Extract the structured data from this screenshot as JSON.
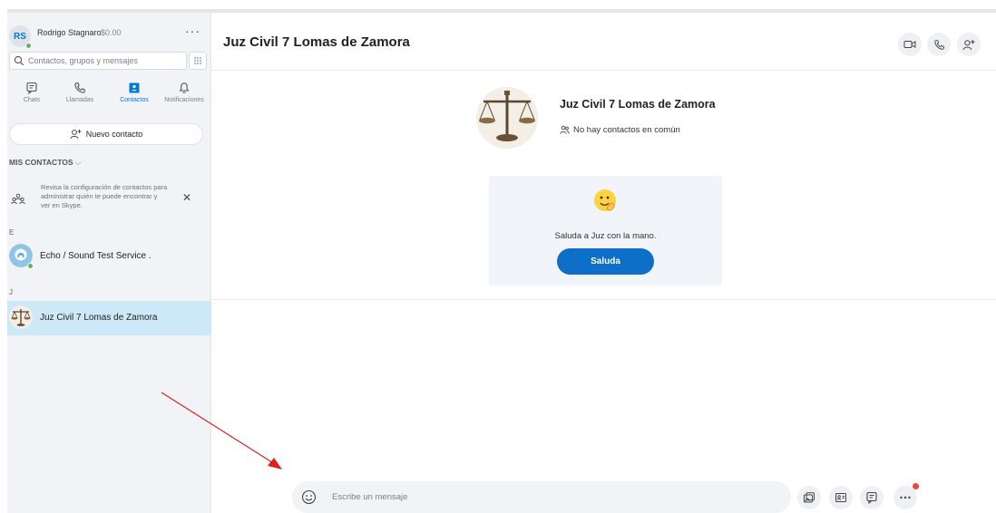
{
  "profile": {
    "initials": "RS",
    "name": "Rodrigo Stagnaro",
    "credit": "$0.00",
    "more": "···"
  },
  "search": {
    "placeholder": "Contactos, grupos y mensajes"
  },
  "nav": [
    {
      "label": "Chats",
      "icon": "chat-icon",
      "active": false
    },
    {
      "label": "Llamadas",
      "icon": "phone-icon",
      "active": false
    },
    {
      "label": "Contactos",
      "icon": "contacts-icon",
      "active": true
    },
    {
      "label": "Notificaciones",
      "icon": "bell-icon",
      "active": false
    }
  ],
  "new_contact": {
    "label": "Nuevo contacto"
  },
  "section": {
    "title": "MIS CONTACTOS",
    "chevron": "⌵"
  },
  "tip": {
    "text": "Revisa la configuración de contactos para administrar quién te puede encontrar y ver en Skype.",
    "close": "✕"
  },
  "contacts": [
    {
      "letter": "E",
      "name": "Echo / Sound Test Service ."
    },
    {
      "letter": "J",
      "name": "Juz Civil 7 Lomas de Zamora",
      "selected": true
    }
  ],
  "chat": {
    "title": "Juz Civil 7 Lomas de Zamora",
    "card_name": "Juz Civil 7 Lomas de Zamora",
    "card_sub": "No hay contactos en común",
    "wave_text": "Saluda a Juz con la mano.",
    "wave_button": "Saluda"
  },
  "composer": {
    "placeholder": "Escribe un mensaje"
  },
  "colors": {
    "accent": "#0078d4",
    "button": "#0d6fc8",
    "selected_row": "#cde8f7",
    "arrow": "#e02020",
    "online": "#5cb85c"
  }
}
